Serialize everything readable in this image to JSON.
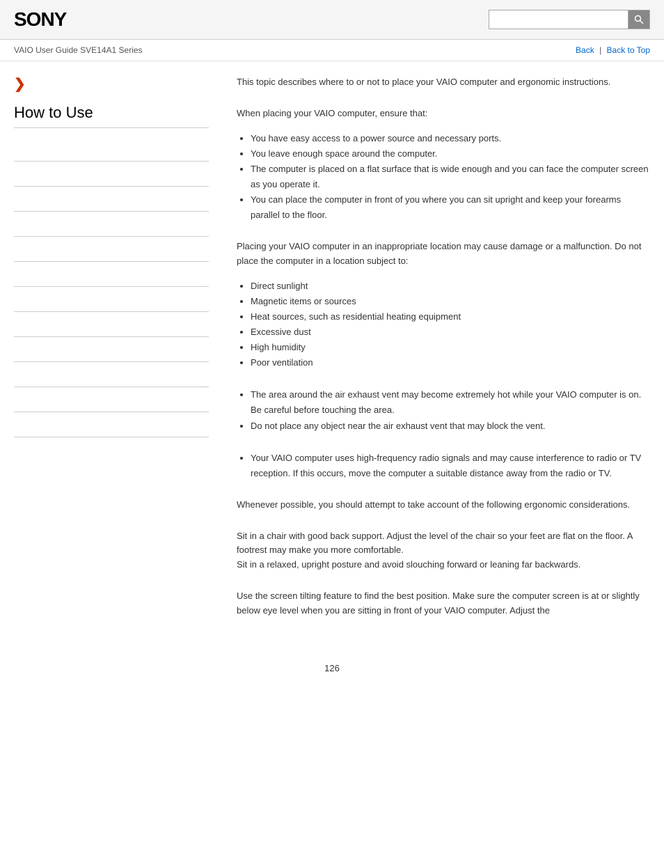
{
  "header": {
    "logo": "SONY",
    "search_placeholder": ""
  },
  "breadcrumb": {
    "text": "VAIO User Guide SVE14A1 Series",
    "back_label": "Back",
    "back_to_top_label": "Back to Top"
  },
  "sidebar": {
    "chevron": "❯",
    "title": "How to Use",
    "items": [
      "",
      "",
      "",
      "",
      "",
      "",
      "",
      "",
      "",
      "",
      "",
      ""
    ]
  },
  "content": {
    "intro": "This topic describes where to or not to place your VAIO computer and ergonomic instructions.",
    "placement_heading": "When placing your VAIO computer, ensure that:",
    "placement_list": [
      "You have easy access to a power source and necessary ports.",
      "You leave enough space around the computer.",
      "The computer is placed on a flat surface that is wide enough and you can face the computer screen as you operate it.",
      "You can place the computer in front of you where you can sit upright and keep your forearms parallel to the floor."
    ],
    "warning_intro": "Placing your VAIO computer in an inappropriate location may cause damage or a malfunction. Do not place the computer in a location subject to:",
    "warning_list": [
      "Direct sunlight",
      "Magnetic items or sources",
      "Heat sources, such as residential heating equipment",
      "Excessive dust",
      "High humidity",
      "Poor ventilation"
    ],
    "vent_list": [
      "The area around the air exhaust vent may become extremely hot while your VAIO computer is on. Be careful before touching the area.",
      "Do not place any object near the air exhaust vent that may block the vent."
    ],
    "radio_list": [
      "Your VAIO computer uses high-frequency radio signals and may cause interference to radio or TV reception. If this occurs, move the computer a suitable distance away from the radio or TV."
    ],
    "ergonomic_intro": "Whenever possible, you should attempt to take account of the following ergonomic considerations.",
    "chair_text": "Sit in a chair with good back support. Adjust the level of the chair so your feet are flat on the floor. A footrest may make you more comfortable.\nSit in a relaxed, upright posture and avoid slouching forward or leaning far backwards.",
    "screen_text": "Use the screen tilting feature to find the best position. Make sure the computer screen is at or slightly below eye level when you are sitting in front of your VAIO computer. Adjust the",
    "page_number": "126"
  }
}
